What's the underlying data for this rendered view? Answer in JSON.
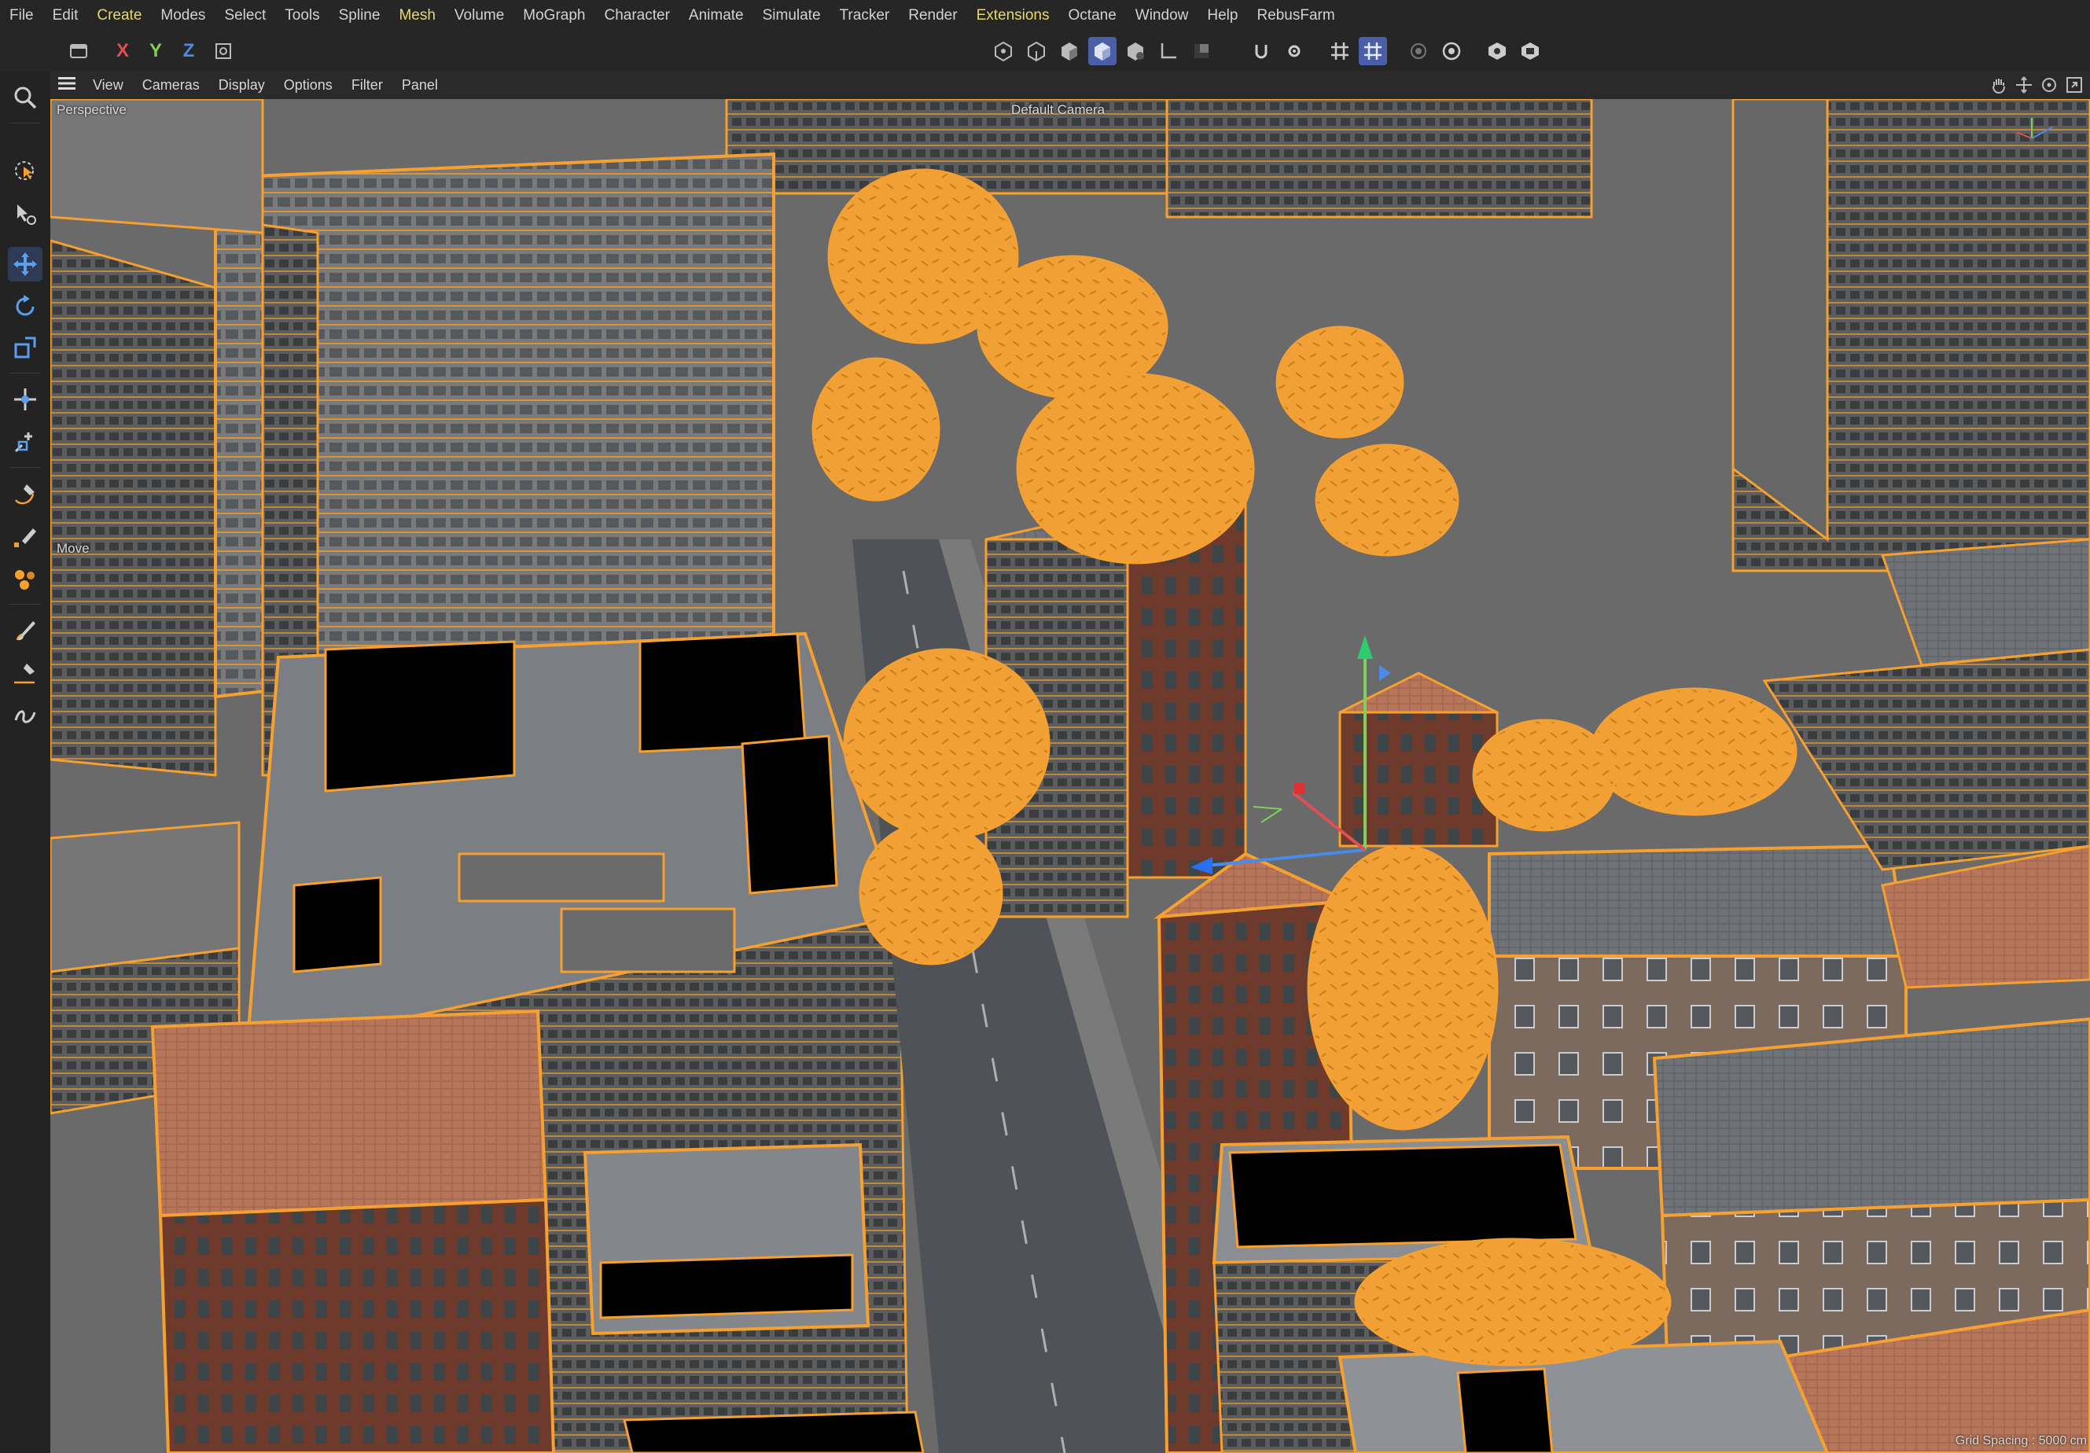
{
  "menu": [
    "File",
    "Edit",
    "Create",
    "Modes",
    "Select",
    "Tools",
    "Spline",
    "Mesh",
    "Volume",
    "MoGraph",
    "Character",
    "Animate",
    "Simulate",
    "Tracker",
    "Render",
    "Extensions",
    "Octane",
    "Window",
    "Help",
    "RebusFarm"
  ],
  "menu_highlight": [
    "Create",
    "Mesh",
    "Extensions"
  ],
  "toolbar": {
    "axis_x": "X",
    "axis_y": "Y",
    "axis_z": "Z"
  },
  "viewport_menu": [
    "View",
    "Cameras",
    "Display",
    "Options",
    "Filter",
    "Panel"
  ],
  "viewport": {
    "view_name": "Perspective",
    "camera_name": "Default Camera",
    "tool_label": "Move",
    "grid_spacing": "Grid Spacing : 5000 cm"
  },
  "colors": {
    "accent": "#f5a030",
    "active_tool": "#4a5fa8",
    "axis_x": "#e05050",
    "axis_y": "#7fd05a",
    "axis_z": "#4a8ae8",
    "menu_highlight": "#e8d96a"
  }
}
